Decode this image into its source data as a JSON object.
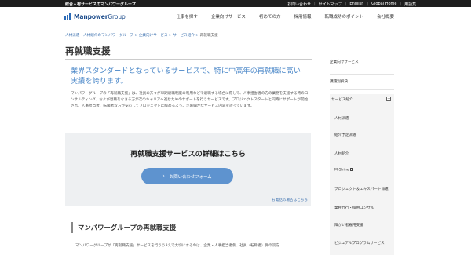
{
  "topbar": {
    "tagline": "総合人材サービスのマンパワーグループ",
    "utility": [
      "お問い合わせ",
      "サイトマップ",
      "English",
      "Global Home",
      "用語集"
    ]
  },
  "header": {
    "logo": {
      "brand": "Manpower",
      "suffix": "Group"
    },
    "nav": [
      "仕事を探す",
      "企業向けサービス",
      "初めての方",
      "採用情報",
      "転職成功のポイント",
      "会社概要"
    ]
  },
  "breadcrumb": {
    "items": [
      "人材派遣・人材紹介のマンパワーグループ",
      "企業向けサービス",
      "サービス紹介"
    ],
    "separator": ">",
    "current": "再就職支援"
  },
  "page": {
    "title": "再就職支援",
    "lead": "業界スタンダードとなっているサービスで、特に中高年の再就職に高い実績を誇ります。",
    "body": "マンパワーグループの「再就職支援」は、社員の方々が早期退職制度の利用などで退職する場合に際して、人事担当者の方の業務を支援する時のコンサルティング、および退職をなさる方が次のキャリアへ進むためのサポートを行うサービスです。プロジェクトスタートと同時にサポートが開始され、人事担当者、転職者双方が安心してプロジェクトに臨めるよう、きめ細かなサービス内容を誇っています。"
  },
  "cta": {
    "heading": "再就職支援サービスの詳細はこちら",
    "button_label": "お問い合わせフォーム",
    "phone_link": "お電話の場合はこちら"
  },
  "section": {
    "heading": "マンパワーグループの再就職支援",
    "text": "マンパワーグループが「再就職支援」サービスを行うう3えで大切にするのは、企業・人事担当者側、社員（転職者）側の双方"
  },
  "sidenav": {
    "items": [
      "企業向けサービス",
      "課題別解決",
      "サービス紹介"
    ],
    "sub_items": [
      "人材派遣",
      "紹介予定派遣",
      "人材紹介",
      "M-Shine",
      "プロジェクト＆エキスパート派遣",
      "業務代行・採用コンサル",
      "障がい者雇用支援",
      "ビジュアルプログラムサービス"
    ],
    "toggle": "－"
  }
}
